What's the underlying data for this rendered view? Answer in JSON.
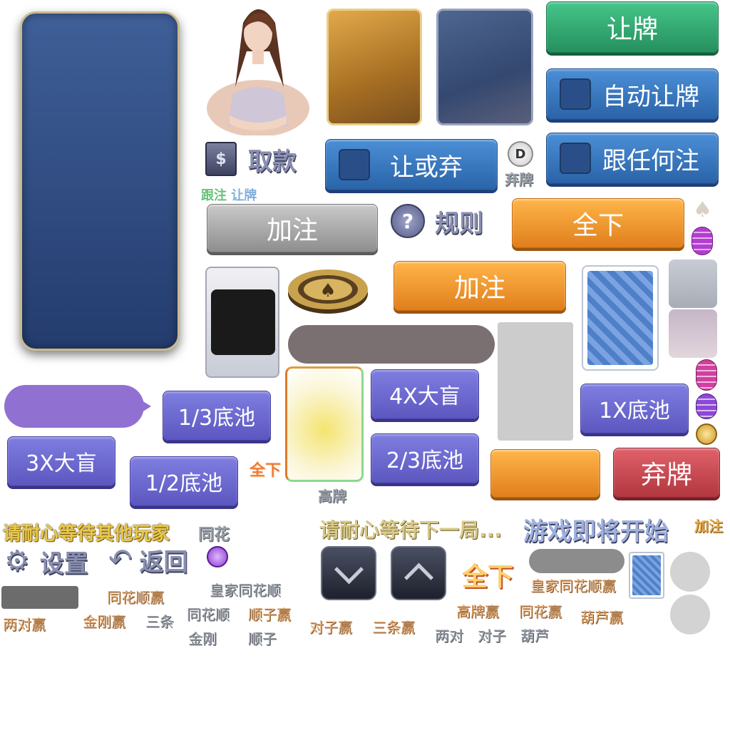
{
  "buttons": {
    "check": "让牌",
    "auto_check": "自动让牌",
    "check_or_fold": "让或弃",
    "call_any": "跟任何注",
    "raise_gray": "加注",
    "all_in": "全下",
    "raise_orange": "加注",
    "fold": "弃牌",
    "third_pot": "1/3底池",
    "four_x_blind": "4X大盲",
    "one_x_pot": "1X底池",
    "three_x_blind": "3X大盲",
    "half_pot": "1/2底池",
    "two_thirds_pot": "2/3底池",
    "settings": "设置",
    "back": "返回",
    "withdraw": "取款",
    "rules": "规则"
  },
  "labels": {
    "dealer": "D",
    "fold_small": "弃牌",
    "follow": "跟注",
    "check_small": "让牌",
    "all_in_small": "全下",
    "high_card_small": "高牌",
    "wait_others": "请耐心等待其他玩家",
    "flush_top": "同花",
    "wait_next": "请耐心等待下一局...",
    "game_start": "游戏即将开始",
    "raise_small": "加注",
    "all_in_big": "全下",
    "royal_flush_win": "皇家同花顺赢"
  },
  "hands_left": {
    "royal_flush": "皇家同花顺",
    "straight_flush_win": "同花顺赢",
    "straight_flush": "同花顺",
    "straight_win": "顺子赢",
    "two_pair_win": "两对赢",
    "quads_win": "金刚赢",
    "trips": "三条",
    "quads": "金刚",
    "straight": "顺子"
  },
  "hands_right": {
    "pair_win": "对子赢",
    "trips_win": "三条赢",
    "high_card_win": "高牌赢",
    "flush_win": "同花赢",
    "full_house_win": "葫芦赢",
    "two_pair": "两对",
    "pair": "对子",
    "full_house": "葫芦"
  },
  "colors": {
    "blue_button": "#2a63a8",
    "green_button": "#25905e",
    "orange_button": "#e07f1d",
    "purple_button": "#5c57c0",
    "red_button": "#b2373f"
  }
}
